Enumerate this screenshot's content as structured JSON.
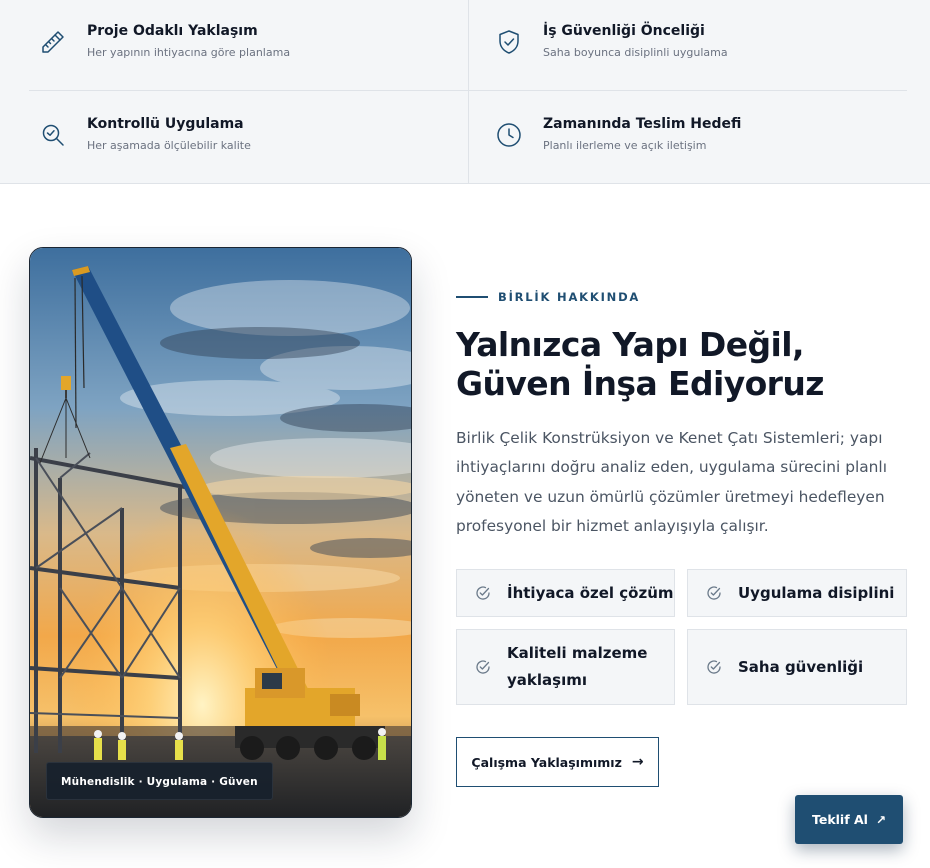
{
  "features": [
    {
      "title": "Proje Odaklı Yaklaşım",
      "subtitle": "Her yapının ihtiyacına göre planlama",
      "icon": "ruler-pencil-icon"
    },
    {
      "title": "İş Güvenliği Önceliği",
      "subtitle": "Saha boyunca disiplinli uygulama",
      "icon": "shield-check-icon"
    },
    {
      "title": "Kontrollü Uygulama",
      "subtitle": "Her aşamada ölçülebilir kalite",
      "icon": "search-icon"
    },
    {
      "title": "Zamanında Teslim Hedefi",
      "subtitle": "Planlı ilerleme ve açık iletişim",
      "icon": "clock-icon"
    }
  ],
  "about": {
    "eyebrow": "BİRLİK HAKKINDA",
    "headline": "Yalnızca Yapı Değil, Güven İnşa Ediyoruz",
    "description": "Birlik Çelik Konstrüksiyon ve Kenet Çatı Sistemleri; yapı ihtiyaçlarını doğru analiz eden, uygulama sürecini planlı yöneten ve uzun ömürlü çözümler üretmeyi hedefleyen profesyonel bir hizmet anlayışıyla çalışır.",
    "image_badge": "Mühendislik · Uygulama · Güven",
    "chips": [
      "İhtiyaca özel çözüm",
      "Uygulama disiplini",
      "Kaliteli malzeme yaklaşımı",
      "Saha güvenliği"
    ],
    "approach_button": "Çalışma Yaklaşımımız",
    "approach_arrow": "→"
  },
  "cta": {
    "label": "Teklif Al",
    "arrow": "↗"
  },
  "colors": {
    "accent": "#1f4e72",
    "surface": "#f4f6f8",
    "border": "#dfe3e8",
    "text": "#111827",
    "muted": "#6b7280"
  }
}
